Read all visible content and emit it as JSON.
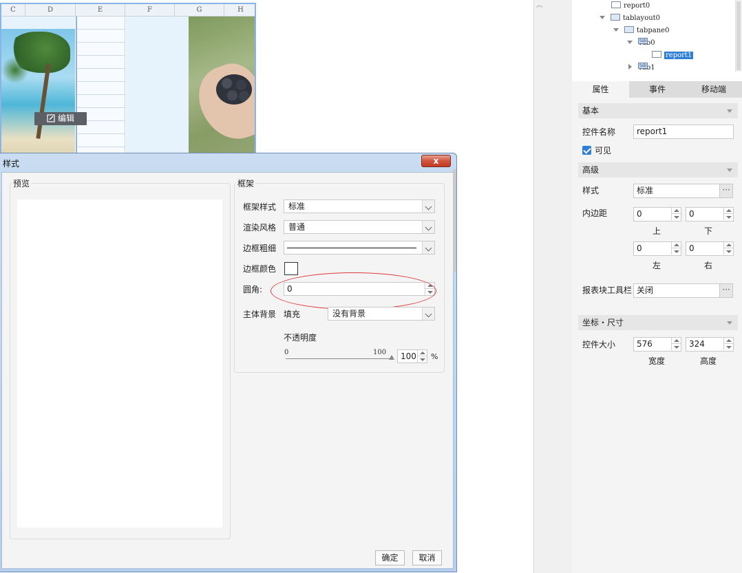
{
  "sheet": {
    "columns": [
      "C",
      "D",
      "E",
      "F",
      "G",
      "H"
    ],
    "edit_button": "编辑"
  },
  "tree": {
    "items": [
      {
        "label": "report0"
      },
      {
        "label": "tablayout0"
      },
      {
        "label": "tabpane0"
      },
      {
        "label": "Tab0"
      },
      {
        "label": "report1",
        "selected": true
      },
      {
        "label": "Tab1"
      }
    ]
  },
  "panel": {
    "tabs": [
      "属性",
      "事件",
      "移动端"
    ],
    "active_tab": "属性",
    "basic": {
      "title": "基本",
      "control_name_label": "控件名称",
      "control_name_value": "report1",
      "visible_label": "可见",
      "visible_checked": true
    },
    "advanced": {
      "title": "高级",
      "style_label": "样式",
      "style_value": "标准",
      "padding_label": "内边距",
      "padding_top": "0",
      "padding_bottom": "0",
      "padding_left": "0",
      "padding_right": "0",
      "top_label": "上",
      "bottom_label": "下",
      "left_label": "左",
      "right_label": "右",
      "toolbar_label": "报表块工具栏",
      "toolbar_value": "关闭"
    },
    "coords": {
      "title": "坐标・尺寸",
      "size_label": "控件大小",
      "width_value": "576",
      "height_value": "324",
      "width_label": "宽度",
      "height_label": "高度"
    }
  },
  "dialog": {
    "title": "样式",
    "close_label": "x",
    "preview_title": "预览",
    "frame_title": "框架",
    "frame_style_label": "框架样式",
    "frame_style_value": "标准",
    "render_label": "渲染风格",
    "render_value": "普通",
    "border_width_label": "边框粗细",
    "border_color_label": "边框颜色",
    "radius_label": "圆角:",
    "radius_value": "0",
    "bg_label": "主体背景",
    "fill_label": "填充",
    "bg_value": "没有背景",
    "opacity_label": "不透明度",
    "slider_min": "0",
    "slider_max": "100",
    "opacity_value": "100",
    "opacity_unit": "%",
    "opacity_level": 1.0,
    "ok_label": "确定",
    "cancel_label": "取消"
  },
  "colors": {
    "selection": "#2e7fd6",
    "highlight_ellipse": "#e0393b"
  }
}
